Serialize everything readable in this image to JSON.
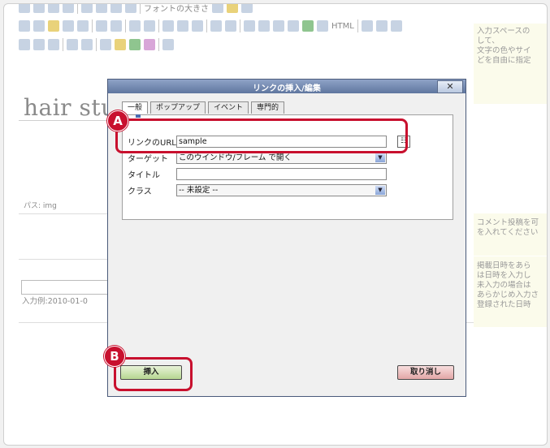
{
  "toolbar": {
    "font_size_label": "フォントの大きさ",
    "html_label": "HTML"
  },
  "editor": {
    "title_text": "hair stu",
    "path_label": "パス: img",
    "date_hint": "入力例:2010-01-0"
  },
  "side_notes": [
    {
      "lines": [
        "入力スペースの",
        "して、",
        "文字の色やサイ",
        "どを自由に指定"
      ]
    },
    {
      "lines": [
        "コメント投稿を可",
        "を入れてください"
      ]
    },
    {
      "lines": [
        "掲載日時をあら",
        "は日時を入力し",
        "未入力の場合は",
        "あらかじめ入力さ",
        "登録された日時"
      ]
    }
  ],
  "dialog": {
    "title": "リンクの挿入/編集",
    "close_label": "✕",
    "tabs": [
      {
        "label": "一般",
        "active": true
      },
      {
        "label": "ポップアップ",
        "active": false
      },
      {
        "label": "イベント",
        "active": false
      },
      {
        "label": "専門的",
        "active": false
      }
    ],
    "fields": {
      "url_label": "リンクのURL",
      "url_value": "sample",
      "target_label": "ターゲット",
      "target_value": "このウインドウ/フレーム で開く",
      "title_label": "タイトル",
      "title_value": "",
      "class_label": "クラス",
      "class_value": "-- 未設定 --"
    },
    "insert_label": "挿入",
    "cancel_label": "取り消し"
  },
  "annotations": {
    "a_label": "A",
    "b_label": "B",
    "color": "#c8102e"
  }
}
